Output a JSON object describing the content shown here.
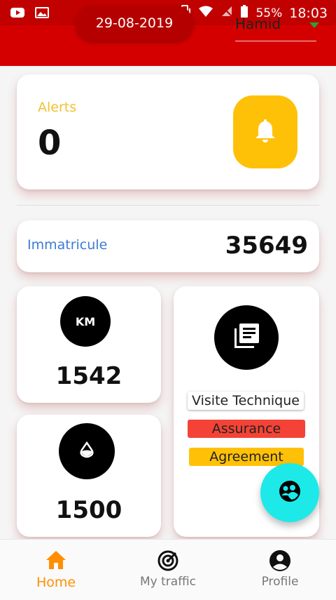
{
  "status_bar": {
    "battery": "55%",
    "time": "18:03"
  },
  "header": {
    "date": "29-08-2019",
    "user": "Hamid"
  },
  "alerts": {
    "label": "Alerts",
    "count": "0"
  },
  "immatricule": {
    "label": "Immatricule",
    "value": "35649"
  },
  "km": {
    "badge": "KM",
    "value": "1542"
  },
  "fuel": {
    "value": "1500"
  },
  "documents": {
    "visite": "Visite Technique",
    "assurance": "Assurance",
    "agreement": "Agreement"
  },
  "colors": {
    "header_red": "#d40000",
    "alert_yellow": "#ffc107",
    "assurance_red": "#f44336",
    "fab_cyan": "#1de9e9",
    "active_orange": "#ff8f00"
  },
  "nav": [
    {
      "label": "Home",
      "icon": "home-icon",
      "active": true
    },
    {
      "label": "My traffic",
      "icon": "radar-icon",
      "active": false
    },
    {
      "label": "Profile",
      "icon": "account-circle-icon",
      "active": false
    }
  ]
}
